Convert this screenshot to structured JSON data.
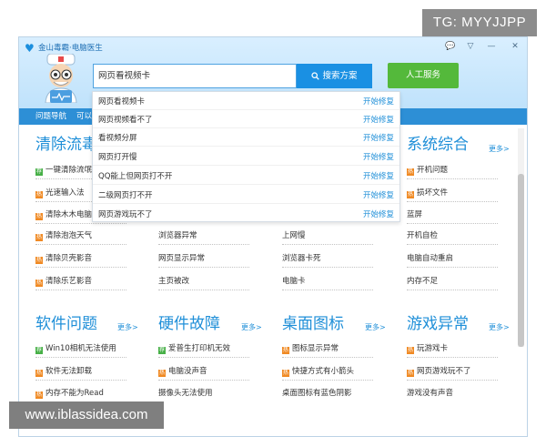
{
  "watermarks": {
    "top": "TG: MYYJJPP",
    "bottom": "www.iblassidea.com"
  },
  "window": {
    "title": "金山毒霸·电脑医生"
  },
  "search": {
    "value": "网页看视频卡",
    "button_label": "搜索方案",
    "service_label": "人工服务"
  },
  "nav": {
    "items": [
      "问题导航",
      "可以"
    ]
  },
  "dropdown": {
    "repair_label": "开始修复",
    "items": [
      "网页看视频卡",
      "网页视频看不了",
      "看视频分屏",
      "网页打开慢",
      "QQ能上但网页打不开",
      "二级网页打不开",
      "网页游戏玩不了"
    ]
  },
  "sections": {
    "clean": {
      "title": "清除流毒",
      "items": [
        "一键清除流氓",
        "光速输入法",
        "清除木木电脑",
        "清除泡泡天气",
        "清除贝壳影音",
        "清除乐艺影音"
      ]
    },
    "col2": {
      "items": [
        "浏览器异常",
        "网页显示异常",
        "主页被改"
      ]
    },
    "col3": {
      "items": [
        "上网慢",
        "浏览器卡死",
        "电脑卡"
      ]
    },
    "system": {
      "title": "系统综合",
      "more": "更多>",
      "items": [
        "开机问题",
        "损坏文件",
        "蓝屏",
        "开机自检",
        "电脑自动重启",
        "内存不足"
      ]
    },
    "software": {
      "title": "软件问题",
      "more": "更多>",
      "items": [
        "Win10相机无法使用",
        "软件无法卸载",
        "内存不能为Read"
      ]
    },
    "hardware": {
      "title": "硬件故障",
      "more": "更多>",
      "items": [
        "爱普生打印机无效",
        "电脑没声音",
        "摄像头无法使用"
      ]
    },
    "desktop": {
      "title": "桌面图标",
      "more": "更多>",
      "items": [
        "图标显示异常",
        "快捷方式有小箭头",
        "桌面图标有蓝色阴影"
      ]
    },
    "game": {
      "title": "游戏异常",
      "more": "更多>",
      "items": [
        "玩游戏卡",
        "网页游戏玩不了",
        "游戏没有声音"
      ]
    }
  },
  "colors": {
    "accent": "#1f8fd8",
    "nav": "#2d8fd6",
    "service": "#54b93b",
    "badge_orange": "#f08a24",
    "badge_green": "#47b047"
  }
}
